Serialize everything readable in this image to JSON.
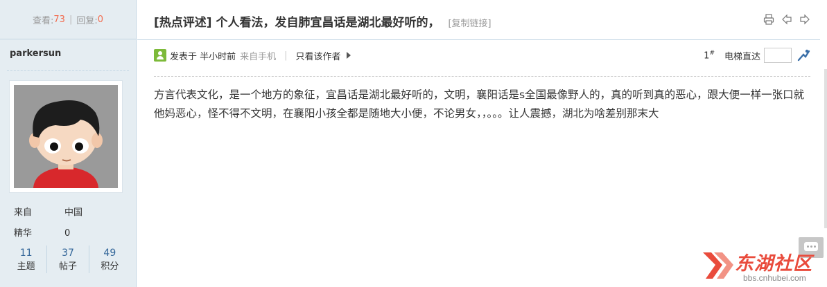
{
  "stats": {
    "view_label": "查看:",
    "view_count": "73",
    "sep": "|",
    "reply_label": "回复:",
    "reply_count": "0"
  },
  "author": {
    "name": "parkersun",
    "from_label": "来自",
    "from_value": "中国",
    "digest_label": "精华",
    "digest_value": "0",
    "counts": [
      {
        "value": "11",
        "label": "主题"
      },
      {
        "value": "37",
        "label": "帖子"
      },
      {
        "value": "49",
        "label": "积分"
      }
    ]
  },
  "post": {
    "title": "[热点评述] 个人看法，发自肺宜昌话是湖北最好听的，",
    "copy_link": "[复制链接]",
    "posted_time": "发表于 半小时前",
    "from_mobile": "来自手机",
    "pipe": "|",
    "only_author": "只看该作者",
    "floor_num": "1",
    "floor_sup": "#",
    "jump_label": "电梯直达",
    "jump_value": "",
    "body": "方言代表文化，是一个地方的象征，宜昌话是湖北最好听的，文明，襄阳话是s全国最像野人的，真的听到真的恶心，跟大便一样一张口就他妈恶心，怪不得不文明，在襄阳小孩全都是随地大小便，不论男女，，。。。让人震撼，湖北为啥差别那末大"
  },
  "logo": {
    "name": "东湖社区",
    "url": "bbs.cnhubei.com"
  },
  "colors": {
    "accent_red": "#f26c4f",
    "sidebar_bg": "#e5edf2",
    "link_blue": "#336699",
    "logo_red": "#e94b3c"
  },
  "icons": {
    "print": "print-icon",
    "prev": "prev-thread-icon",
    "next": "next-thread-icon",
    "poster": "poster-icon",
    "jump_go": "jump-go-icon",
    "chat": "chat-icon"
  }
}
